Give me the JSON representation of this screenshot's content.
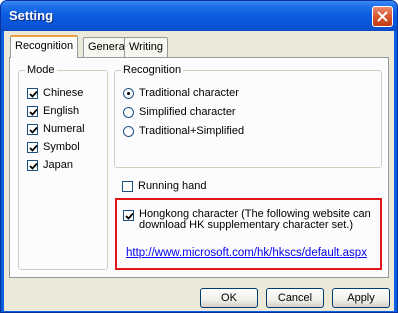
{
  "window": {
    "title": "Setting"
  },
  "tabs": [
    "Recognition",
    "General",
    "Writing"
  ],
  "mode": {
    "legend": "Mode",
    "items": [
      {
        "label": "Chinese",
        "checked": true
      },
      {
        "label": "English",
        "checked": true
      },
      {
        "label": "Numeral",
        "checked": true
      },
      {
        "label": "Symbol",
        "checked": true
      },
      {
        "label": "Japan",
        "checked": true
      }
    ]
  },
  "recognition": {
    "legend": "Recognition",
    "options": [
      {
        "label": "Traditional character",
        "selected": true
      },
      {
        "label": "Simplified character",
        "selected": false
      },
      {
        "label": "Traditional+Simplified",
        "selected": false
      }
    ],
    "running_hand": {
      "label": "Running hand",
      "checked": false
    },
    "hongkong": {
      "label_line1": "Hongkong character (The following website can",
      "label_line2": "download HK supplementary character set.)",
      "checked": true,
      "link": "http://www.microsoft.com/hk/hkscs/default.aspx"
    }
  },
  "buttons": {
    "ok": "OK",
    "cancel": "Cancel",
    "apply": "Apply"
  },
  "colors": {
    "title_bar": "#0a5ae0",
    "highlight_border": "#e0161b",
    "link": "#0000ee"
  }
}
